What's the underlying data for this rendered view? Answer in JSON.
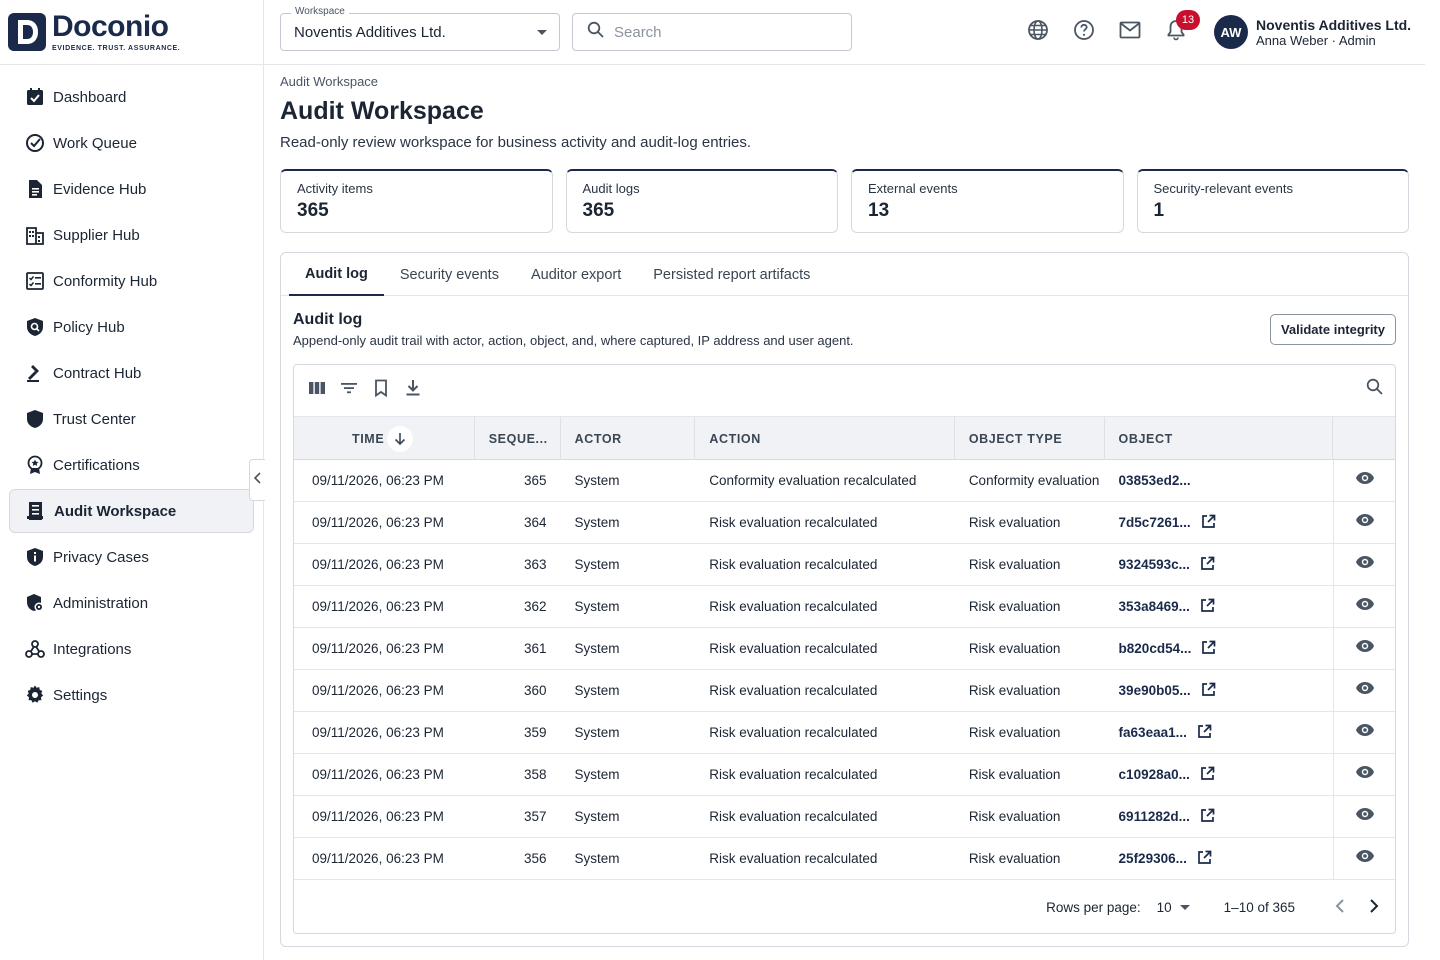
{
  "brand": {
    "name": "Doconio",
    "tagline": "EVIDENCE. TRUST. ASSURANCE.",
    "logo_letter": "D"
  },
  "sidebar": {
    "items": [
      {
        "label": "Dashboard",
        "icon": "dashboard-check-icon"
      },
      {
        "label": "Work Queue",
        "icon": "circle-check-icon"
      },
      {
        "label": "Evidence Hub",
        "icon": "document-icon"
      },
      {
        "label": "Supplier Hub",
        "icon": "building-icon"
      },
      {
        "label": "Conformity Hub",
        "icon": "checklist-icon"
      },
      {
        "label": "Policy Hub",
        "icon": "policy-shield-icon"
      },
      {
        "label": "Contract Hub",
        "icon": "gavel-icon"
      },
      {
        "label": "Trust Center",
        "icon": "shield-icon"
      },
      {
        "label": "Certifications",
        "icon": "award-icon"
      },
      {
        "label": "Audit Workspace",
        "icon": "audit-list-icon",
        "active": true
      },
      {
        "label": "Privacy Cases",
        "icon": "privacy-shield-icon"
      },
      {
        "label": "Administration",
        "icon": "admin-shield-icon"
      },
      {
        "label": "Integrations",
        "icon": "webhook-icon"
      },
      {
        "label": "Settings",
        "icon": "gear-icon"
      }
    ]
  },
  "topbar": {
    "workspace_label": "Workspace",
    "workspace_value": "Noventis Additives Ltd.",
    "search_placeholder": "Search",
    "notification_count": "13",
    "avatar_initials": "AW",
    "user_org": "Noventis Additives Ltd.",
    "user_sub": "Anna Weber · Admin"
  },
  "page": {
    "breadcrumb": "Audit Workspace",
    "title": "Audit Workspace",
    "description": "Read-only review workspace for business activity and audit-log entries."
  },
  "stats": [
    {
      "label": "Activity items",
      "value": "365"
    },
    {
      "label": "Audit logs",
      "value": "365"
    },
    {
      "label": "External events",
      "value": "13"
    },
    {
      "label": "Security-relevant events",
      "value": "1"
    }
  ],
  "tabs": [
    "Audit log",
    "Security events",
    "Auditor export",
    "Persisted report artifacts"
  ],
  "section": {
    "title": "Audit log",
    "description": "Append-only audit trail with actor, action, object, and, where captured, IP address and user agent.",
    "validate_label": "Validate integrity"
  },
  "table": {
    "columns": [
      "TIME",
      "SEQUE...",
      "ACTOR",
      "ACTION",
      "OBJECT TYPE",
      "OBJECT"
    ],
    "rows": [
      {
        "time": "09/11/2026, 06:23 PM",
        "seq": "365",
        "actor": "System",
        "action": "Conformity evaluation recalculated",
        "otype": "Conformity evaluation",
        "obj": "03853ed2...",
        "link": false
      },
      {
        "time": "09/11/2026, 06:23 PM",
        "seq": "364",
        "actor": "System",
        "action": "Risk evaluation recalculated",
        "otype": "Risk evaluation",
        "obj": "7d5c7261...",
        "link": true
      },
      {
        "time": "09/11/2026, 06:23 PM",
        "seq": "363",
        "actor": "System",
        "action": "Risk evaluation recalculated",
        "otype": "Risk evaluation",
        "obj": "9324593c...",
        "link": true
      },
      {
        "time": "09/11/2026, 06:23 PM",
        "seq": "362",
        "actor": "System",
        "action": "Risk evaluation recalculated",
        "otype": "Risk evaluation",
        "obj": "353a8469...",
        "link": true
      },
      {
        "time": "09/11/2026, 06:23 PM",
        "seq": "361",
        "actor": "System",
        "action": "Risk evaluation recalculated",
        "otype": "Risk evaluation",
        "obj": "b820cd54...",
        "link": true
      },
      {
        "time": "09/11/2026, 06:23 PM",
        "seq": "360",
        "actor": "System",
        "action": "Risk evaluation recalculated",
        "otype": "Risk evaluation",
        "obj": "39e90b05...",
        "link": true
      },
      {
        "time": "09/11/2026, 06:23 PM",
        "seq": "359",
        "actor": "System",
        "action": "Risk evaluation recalculated",
        "otype": "Risk evaluation",
        "obj": "fa63eaa1...",
        "link": true
      },
      {
        "time": "09/11/2026, 06:23 PM",
        "seq": "358",
        "actor": "System",
        "action": "Risk evaluation recalculated",
        "otype": "Risk evaluation",
        "obj": "c10928a0...",
        "link": true
      },
      {
        "time": "09/11/2026, 06:23 PM",
        "seq": "357",
        "actor": "System",
        "action": "Risk evaluation recalculated",
        "otype": "Risk evaluation",
        "obj": "6911282d...",
        "link": true
      },
      {
        "time": "09/11/2026, 06:23 PM",
        "seq": "356",
        "actor": "System",
        "action": "Risk evaluation recalculated",
        "otype": "Risk evaluation",
        "obj": "25f29306...",
        "link": true
      }
    ],
    "rows_per_page_label": "Rows per page:",
    "rows_per_page": "10",
    "range": "1–10 of 365"
  },
  "colors": {
    "primary": "#1b2a4a",
    "badge": "#c8102e",
    "active_bg": "#f0f2f5"
  }
}
